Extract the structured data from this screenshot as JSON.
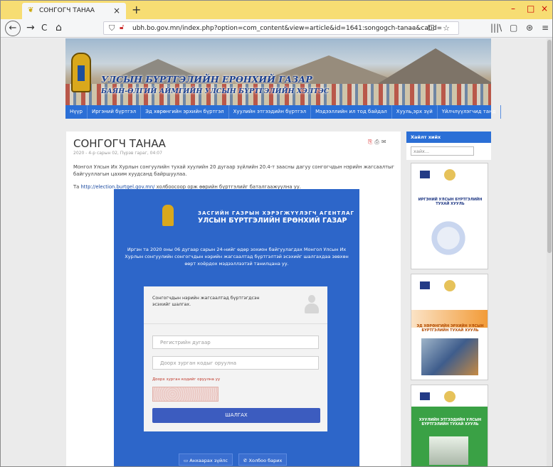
{
  "browser": {
    "tab_title": "СОНГОГЧ ТАНАА",
    "tab_close": "×",
    "new_tab": "+",
    "url": "ubh.bo.gov.mn/index.php?option=com_content&view=article&id=1641:songogch-tanaa&catid=",
    "url_actions": "··· ☐ ☆",
    "nav": {
      "back": "←",
      "forward": "→",
      "reload": "C",
      "home": "⌂"
    },
    "right_tools": [
      "|||\\",
      "▢",
      "⊛",
      "≡"
    ],
    "window_controls": [
      "–",
      "□",
      "×"
    ]
  },
  "site": {
    "banner_title": "УЛСЫН БҮРТГЭЛИЙН ЕРӨНХИЙ ГАЗАР",
    "banner_subtitle": "БАЯН-ӨЛГИЙ АЙМГИЙН УЛСЫН БҮРТГЭЛИЙН ХЭЛТЭС",
    "menu": [
      "Нүүр",
      "Иргэний бүртгэл",
      "Эд хөрөнгийн эрхийн бүртгэл",
      "Хуулийн этгээдийн бүртгэл",
      "Мэдээллийн ил тод байдал",
      "Хууль,эрх зүй",
      "Үйлчлүүлэгчид танд"
    ]
  },
  "article": {
    "title": "СОНГОГЧ ТАНАА",
    "date": "2020 - 4-р сарын 02, Пүрэв гараг, 04:07",
    "icons": [
      "pdf-icon",
      "print-icon",
      "email-icon"
    ],
    "paragraph": "Монгол Улсын Их Хурлын сонгуулийн тухай хуулийн 20 дугаар зүйлийн 20.4-т заасны дагуу сонгогчдын нэрийн жагсаалтыг байгууллагын цахим хуудсанд байршуулаа.",
    "link_prefix": "Та",
    "link_text": "http://election.burtgel.gov.mn/",
    "link_suffix": "холбоосоор орж өөрийн бүртгэлийг баталгаажуулна уу."
  },
  "embed": {
    "agency_line1": "ЗАСГИЙН ГАЗРЫН ХЭРЭГЖҮҮЛЭГЧ АГЕНТЛАГ",
    "agency_line2": "УЛСЫН БҮРТГЭЛИЙН ЕРӨНХИЙ ГАЗАР",
    "intro": "Иргэн та 2020 оны 06 дугаар сарын 24-нийг өдөр зохион байгуулагдах Монгол Улсын Их Хурлын сонгуулийн сонгогчдын нэрийн жагсаалтад бүртгэлтэй эсэхийг шалгахдаа зөвхөн өөрт хоёрдох мэдээллээтэй танилцана уу.",
    "card_title": "Сонгогчдын нэрийн жагсаалтад бүртгэгдсэн эсэхийг шалгах.",
    "reg_placeholder": "Регистрийн дугаар",
    "code_placeholder": "Доорх зурган кодыг оруулна",
    "error": "Доорх зурган кодийг оруулна уу",
    "check_button": "ШАЛГАХ",
    "help_button": "Анхаарах зүйлс",
    "contact_button": "Холбоо барих"
  },
  "sidebar": {
    "search_title": "Хайлт хийх",
    "search_placeholder": "хайх...",
    "books": [
      {
        "title": "ИРГЭНИЙ УЛСЫН БҮРТГЭЛИЙН ТУХАЙ ХУУЛЬ",
        "color": "#233b86"
      },
      {
        "title": "ЭД ХӨРӨНГИЙН ЭРХИЙН УЛСЫН БҮРТГЭЛИЙН ТУХАЙ ХУУЛЬ",
        "color": "#e07a1f"
      },
      {
        "title": "ХУУЛИЙН ЭТГЭЭДИЙН УЛСЫН БҮРТГЭЛИЙН ТУХАЙ ХУУЛЬ",
        "color": "#ffffff"
      }
    ]
  }
}
